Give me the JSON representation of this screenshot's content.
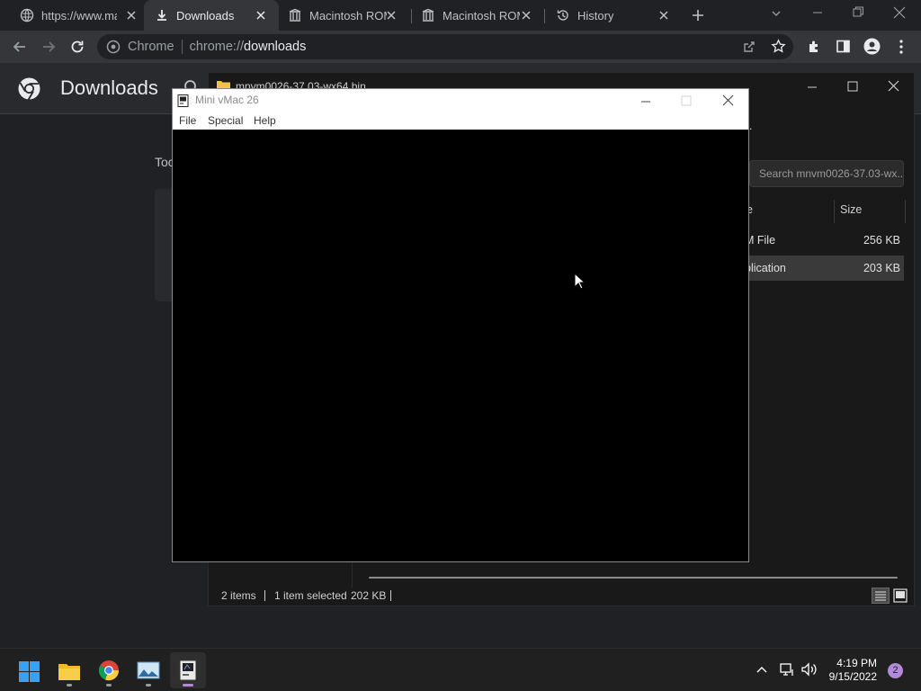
{
  "browser": {
    "tabs": [
      {
        "title": "https://www.ma",
        "icon": "globe-icon"
      },
      {
        "title": "Downloads",
        "icon": "download-icon",
        "active": true
      },
      {
        "title": "Macintosh ROM",
        "icon": "archive-icon"
      },
      {
        "title": "Macintosh ROM",
        "icon": "archive-icon"
      },
      {
        "title": "History",
        "icon": "history-icon"
      }
    ],
    "omnibox": {
      "site_label": "Chrome",
      "scheme": "chrome://",
      "host": "downloads"
    }
  },
  "downloads_page": {
    "title": "Downloads",
    "section_date_partial": "Toc"
  },
  "explorer": {
    "title": "mnvm0026-37.03-wx64.bin",
    "search_placeholder": "Search mnvm0026-37.03-wx...",
    "columns": {
      "type_partial": "e",
      "size": "Size"
    },
    "rows": [
      {
        "type_partial": "M File",
        "size": "256 KB",
        "selected": false
      },
      {
        "type_partial": "plication",
        "size": "203 KB",
        "selected": true
      }
    ],
    "status": {
      "items": "2 items",
      "selected": "1 item selected",
      "selected_size": "202 KB"
    }
  },
  "vmac": {
    "title": "Mini vMac 26",
    "menu": {
      "file": "File",
      "special": "Special",
      "help": "Help"
    }
  },
  "taskbar": {
    "apps": [
      "windows-start-icon",
      "file-explorer-icon",
      "chrome-icon",
      "photos-icon",
      "mini-vmac-icon"
    ],
    "clock": {
      "time": "4:19 PM",
      "date": "9/15/2022"
    },
    "notification_count": "2"
  },
  "colors": {
    "accent": "#b38ad8",
    "chrome_dark": "#202124",
    "toolbar": "#35363a"
  }
}
